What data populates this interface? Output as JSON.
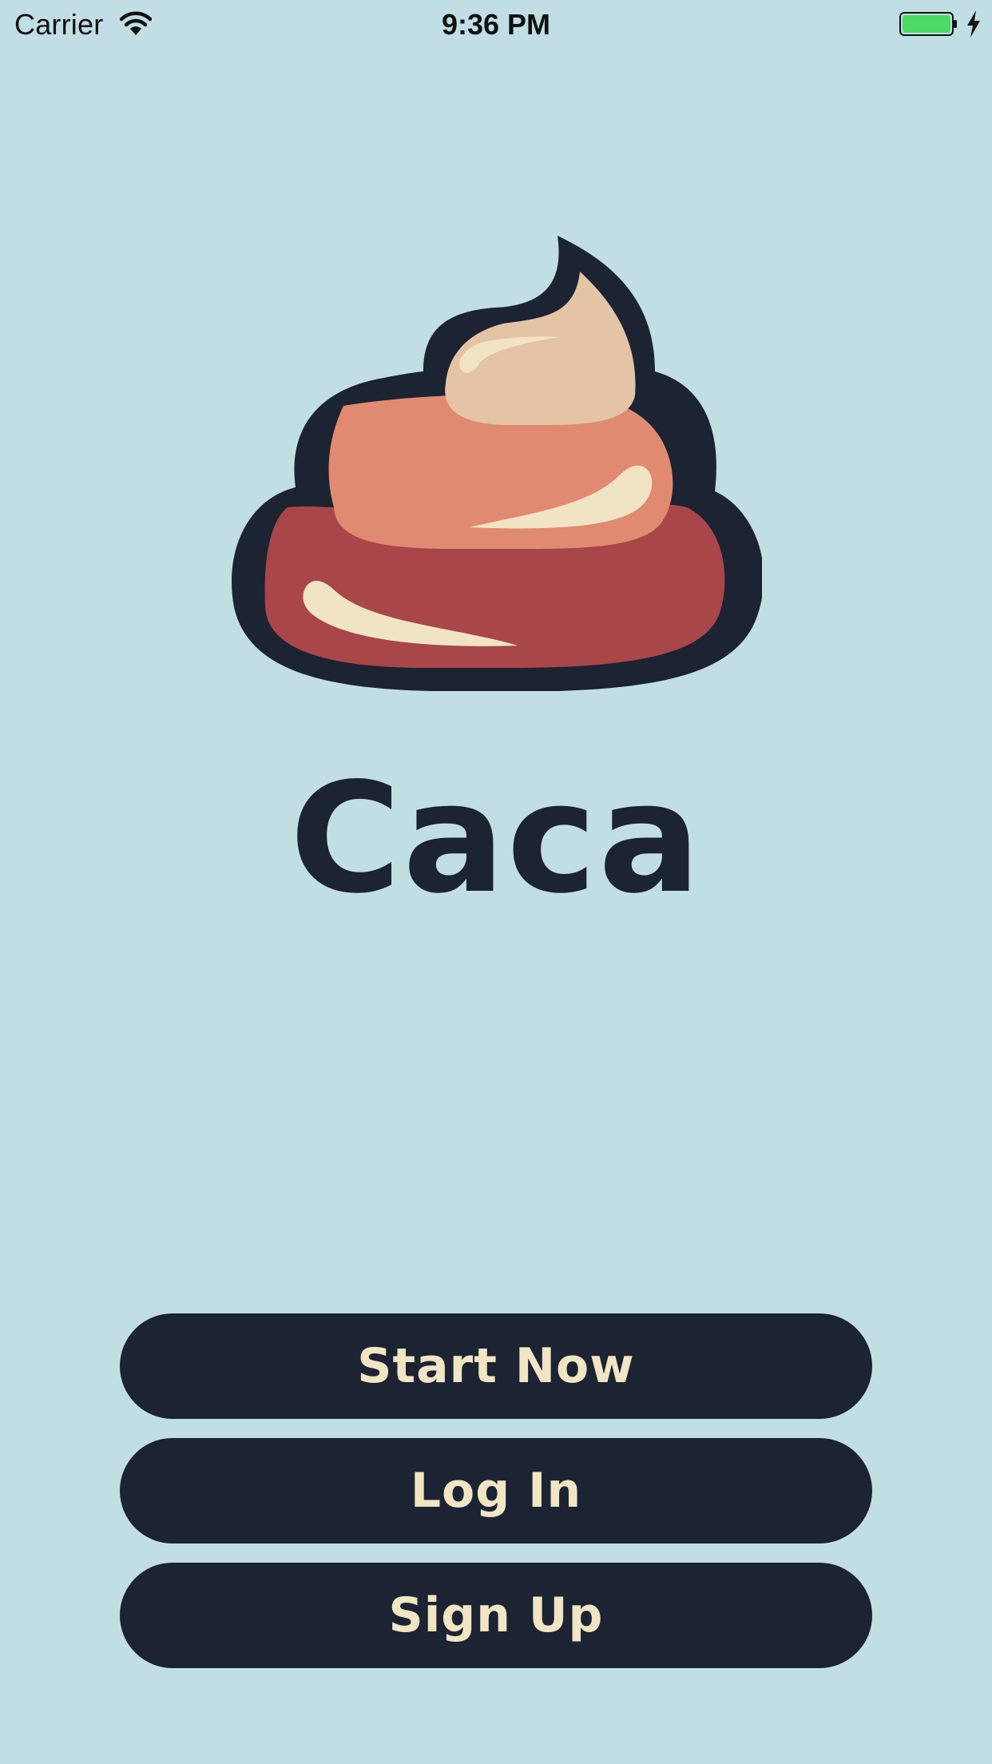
{
  "status_bar": {
    "carrier": "Carrier",
    "time": "9:36 PM",
    "icons": [
      "wifi-icon",
      "battery-icon",
      "charging-icon"
    ]
  },
  "app": {
    "logo_icon": "poop-swirl-logo",
    "title": "Caca"
  },
  "actions": {
    "start_now": "Start Now",
    "log_in": "Log In",
    "sign_up": "Sign Up"
  },
  "colors": {
    "background": "#c1dee4",
    "dark": "#1c2333",
    "button_text": "#f1e5c4",
    "swirl_top": "#e5c3a5",
    "swirl_middle": "#e08a71",
    "swirl_bottom": "#a94649",
    "highlight": "#f0e4c4",
    "battery": "#4cd964"
  }
}
